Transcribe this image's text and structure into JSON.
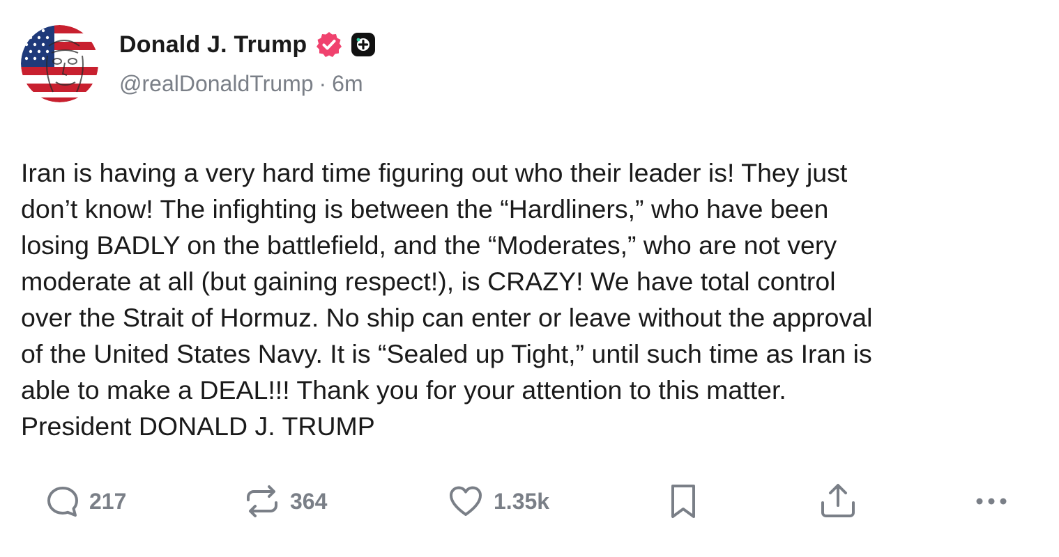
{
  "author": {
    "display_name": "Donald J. Trump",
    "handle": "@realDonaldTrump",
    "separator": "·",
    "time": "6m",
    "avatar_icon": "profile-avatar-flag-portrait",
    "verified_icon": "verified-badge-icon",
    "verified_color": "#f0426e",
    "plus_icon": "plus-badge-icon"
  },
  "post": {
    "text": "Iran is having a very hard time figuring out who their leader is! They just\ndon’t know! The infighting is between the “Hardliners,” who have been\nlosing BADLY on the battlefield, and the “Moderates,” who are not very\nmoderate at all (but gaining respect!), is CRAZY! We have total control\nover the Strait of Hormuz. No ship can enter or leave without the approval\nof the United States Navy. It is “Sealed up Tight,” until such time as Iran is\nable to make a DEAL!!! Thank you for your attention to this matter.\nPresident DONALD J. TRUMP"
  },
  "actions": {
    "reply": {
      "icon": "reply-icon",
      "count": "217"
    },
    "repost": {
      "icon": "repost-icon",
      "count": "364"
    },
    "like": {
      "icon": "heart-icon",
      "count": "1.35k"
    },
    "bookmark": {
      "icon": "bookmark-icon"
    },
    "share": {
      "icon": "share-icon"
    },
    "more": {
      "icon": "more-icon"
    }
  },
  "colors": {
    "text": "#1a1a1a",
    "muted": "#7a7f87",
    "verified": "#f0426e",
    "background": "#ffffff"
  }
}
